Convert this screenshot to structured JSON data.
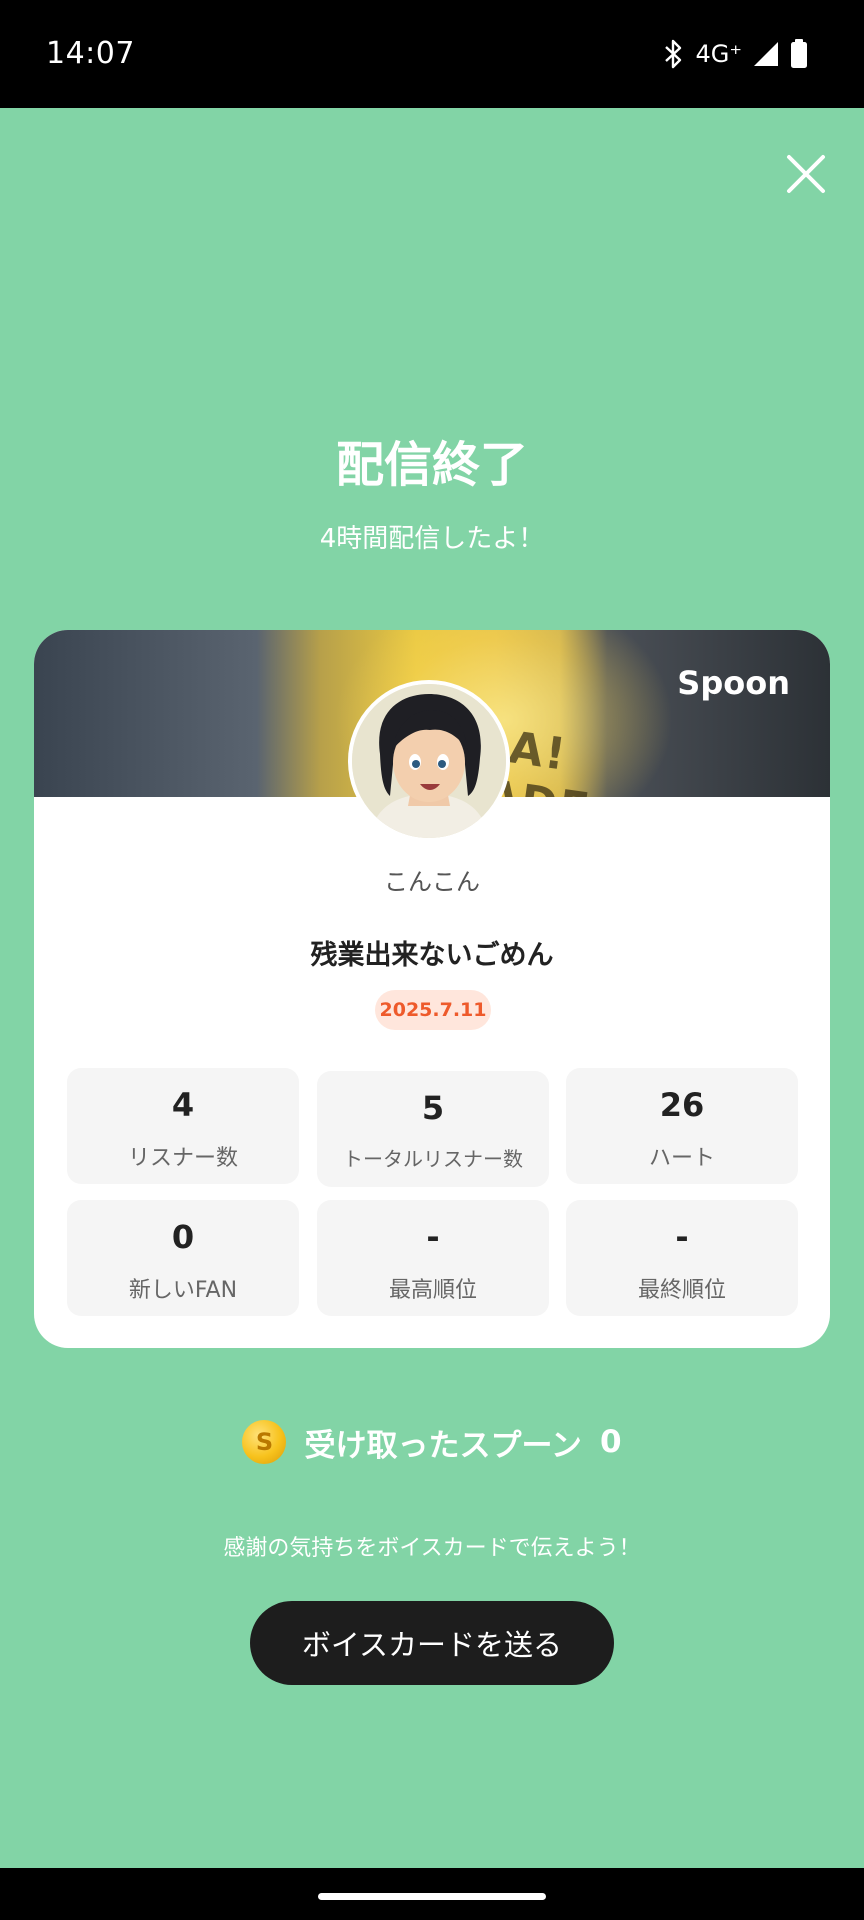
{
  "status_bar": {
    "time": "14:07",
    "network": "4G⁺"
  },
  "header": {
    "title": "配信終了",
    "subtitle": "4時間配信したよ！"
  },
  "card": {
    "brand": "Spoon",
    "banner_text": "...A! NADE",
    "username": "こんこん",
    "live_title": "残業出来ないごめん",
    "date": "2025.7.11",
    "stats": [
      {
        "value": "4",
        "label": "リスナー数"
      },
      {
        "value": "5",
        "label": "トータルリスナー数"
      },
      {
        "value": "26",
        "label": "ハート"
      },
      {
        "value": "0",
        "label": "新しいFAN"
      },
      {
        "value": "-",
        "label": "最高順位"
      },
      {
        "value": "-",
        "label": "最終順位"
      }
    ]
  },
  "spoons": {
    "label": "受け取ったスプーン",
    "count": "0",
    "coin_symbol": "S"
  },
  "footer": {
    "message": "感謝の気持ちをボイスカードで伝えよう！",
    "button_label": "ボイスカードを送る"
  }
}
